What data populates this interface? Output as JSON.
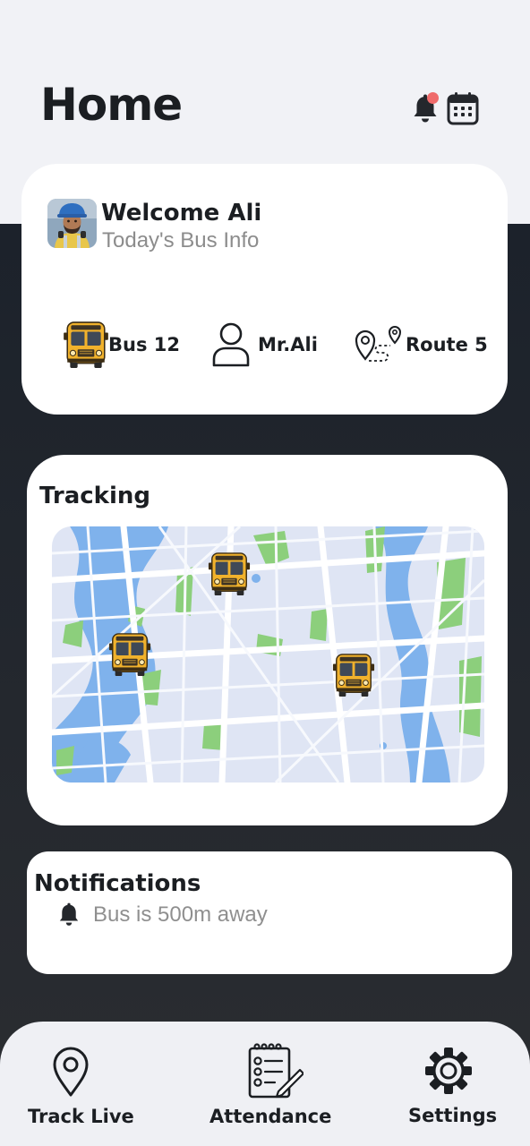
{
  "header": {
    "title": "Home",
    "icons": [
      "bell-icon",
      "calendar-icon"
    ],
    "notification_dot_color": "#ef6b6b"
  },
  "welcome": {
    "title": "Welcome Ali",
    "subtitle": "Today's Bus Info",
    "info": {
      "bus": "Bus 12",
      "driver": "Mr.Ali",
      "route": "Route 5"
    }
  },
  "tracking": {
    "title": "Tracking",
    "bus_markers": 3
  },
  "notifications": {
    "title": "Notifications",
    "items": [
      {
        "icon": "bell-icon",
        "text": "Bus is 500m away"
      }
    ]
  },
  "nav": {
    "items": [
      {
        "icon": "location-pin-icon",
        "label": "Track Live"
      },
      {
        "icon": "checklist-icon",
        "label": "Attendance"
      },
      {
        "icon": "gear-icon",
        "label": "Settings"
      }
    ]
  },
  "colors": {
    "background_dark": "#1c222b",
    "surface": "#ffffff",
    "top_background": "#f1f2f6",
    "nav_background": "#eff0f4",
    "map_water": "#7fb2ec",
    "map_park": "#8ccf7c",
    "bus_yellow": "#f0b429"
  }
}
